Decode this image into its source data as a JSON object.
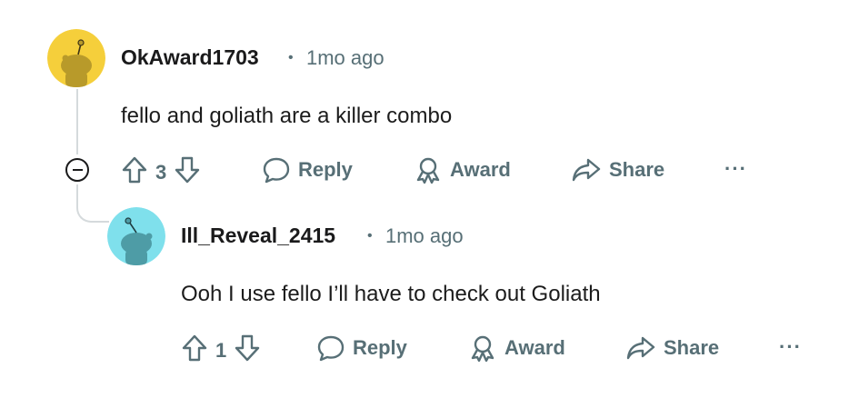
{
  "comments": [
    {
      "username": "OkAward1703",
      "separator": "•",
      "time": "1mo ago",
      "body": "fello and goliath are a killer combo",
      "avatar_color": "#F5CF3B",
      "avatar_figure_color": "#B89A2A",
      "vote_count": "3",
      "actions": {
        "reply": "Reply",
        "award": "Award",
        "share": "Share",
        "more": "···"
      }
    },
    {
      "username": "Ill_Reveal_2415",
      "separator": "•",
      "time": "1mo ago",
      "body": "Ooh I use fello I’ll have to check out Goliath",
      "avatar_color": "#7FE0EC",
      "avatar_figure_color": "#4E9CA6",
      "vote_count": "1",
      "actions": {
        "reply": "Reply",
        "award": "Award",
        "share": "Share",
        "more": "···"
      }
    }
  ],
  "colors": {
    "meta_gray": "#576f76",
    "thread_line": "#d5dadc",
    "text": "#1c1c1c"
  },
  "icons": [
    "upvote-icon",
    "downvote-icon",
    "reply-icon",
    "award-icon",
    "share-icon",
    "collapse-icon",
    "more-icon"
  ]
}
